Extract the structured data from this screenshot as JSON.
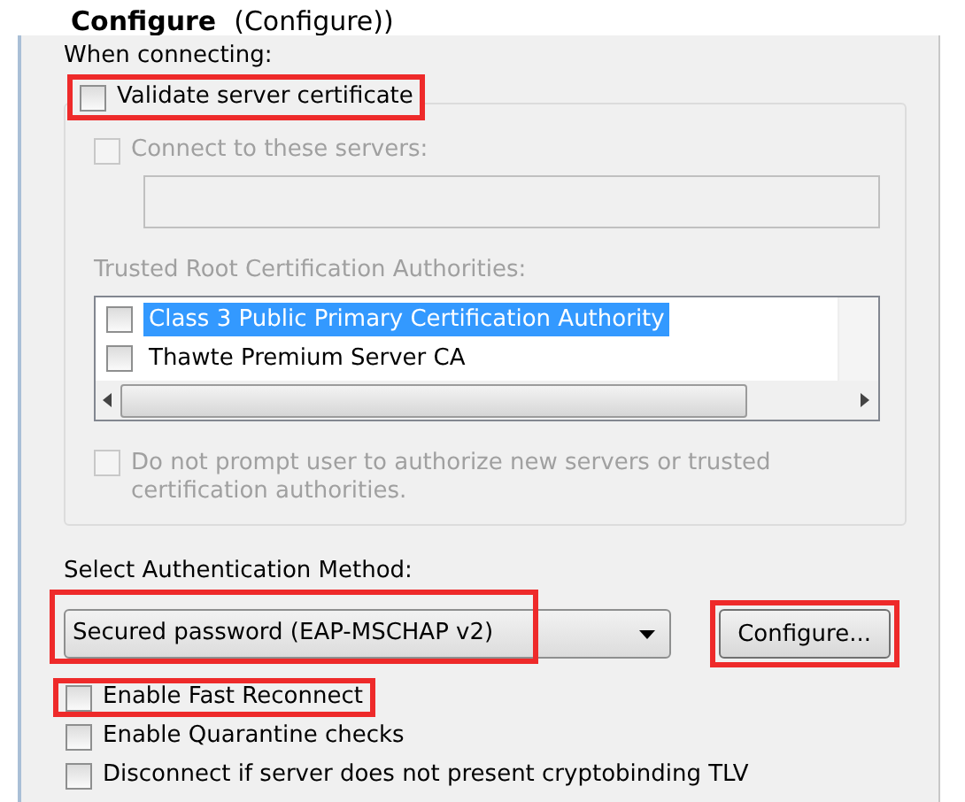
{
  "caption": {
    "bold": "Configure",
    "rest": "(Configure))"
  },
  "when_connecting": {
    "label": "When connecting:"
  },
  "validate": {
    "label": "Validate server certificate",
    "checked": false,
    "disabled": false,
    "highlighted": true
  },
  "connect_servers": {
    "label": "Connect to these servers:",
    "checked": false,
    "disabled": true
  },
  "trusted_root": {
    "label": "Trusted Root Certification Authorities:",
    "items": [
      {
        "label": "Class 3 Public Primary Certification Authority",
        "checked": false,
        "selected": true
      },
      {
        "label": "Thawte Premium Server CA",
        "checked": false,
        "selected": false
      }
    ]
  },
  "do_not_prompt": {
    "label": "Do not prompt user to authorize new servers or trusted certification authorities.",
    "checked": false,
    "disabled": true
  },
  "auth_method": {
    "label": "Select Authentication Method:",
    "value": "Secured password (EAP-MSCHAP v2)",
    "highlighted": true
  },
  "configure_button": {
    "label": "Configure...",
    "highlighted": true
  },
  "options": [
    {
      "label": "Enable Fast Reconnect",
      "checked": false,
      "highlighted": true
    },
    {
      "label": "Enable Quarantine checks",
      "checked": false,
      "highlighted": false
    },
    {
      "label": "Disconnect if server does not present cryptobinding TLV",
      "checked": false,
      "highlighted": false
    }
  ]
}
